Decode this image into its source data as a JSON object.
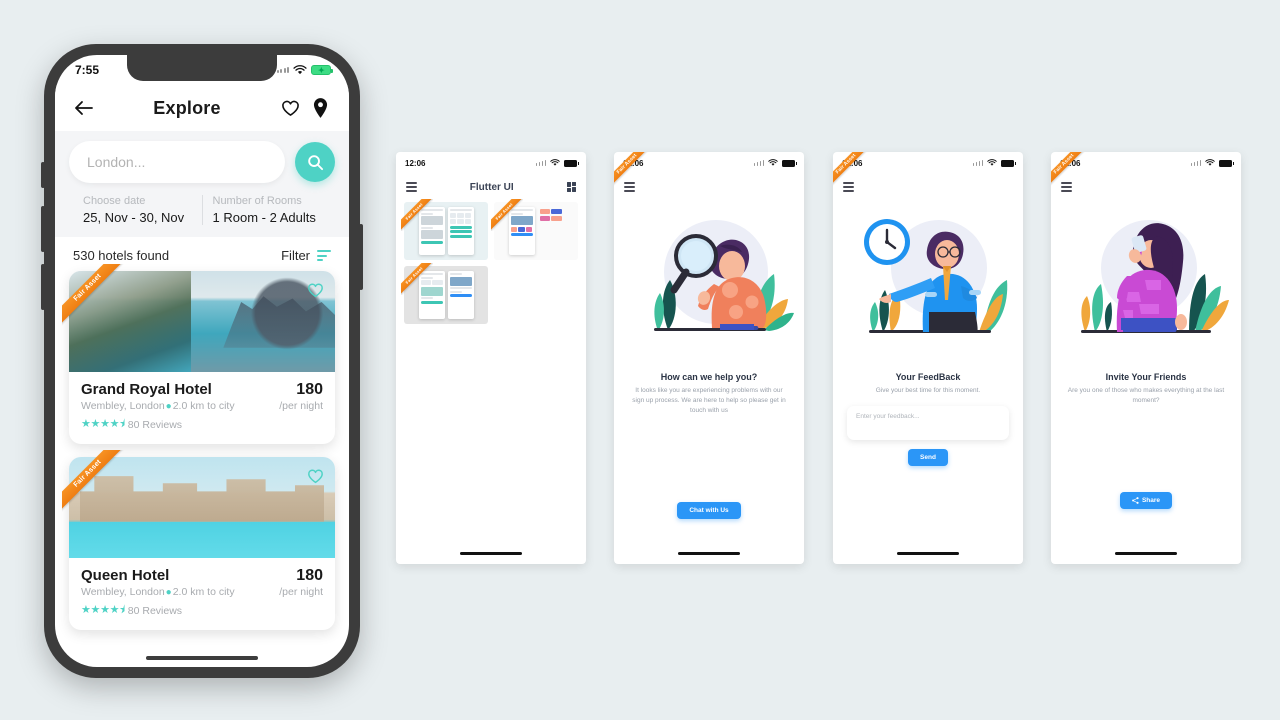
{
  "page": {
    "background_color": "#e8eef0",
    "ribbon_label": "Fair Asset",
    "accent_teal": "#4ed2c5",
    "accent_blue": "#2b96f7",
    "accent_orange": "#f08014"
  },
  "phone_main": {
    "status": {
      "time": "7:55",
      "wifi_icon": "wifi-icon",
      "battery_icon": "battery-charging-icon"
    },
    "appbar": {
      "back_icon": "arrow-left-icon",
      "title": "Explore",
      "favorite_icon": "heart-icon",
      "location_icon": "map-pin-icon"
    },
    "search": {
      "placeholder": "London...",
      "value": "London...",
      "button_icon": "search-icon"
    },
    "filters": {
      "date_label": "Choose date",
      "date_value": "25, Nov - 30, Nov",
      "rooms_label": "Number of Rooms",
      "rooms_value": "1 Room - 2 Adults"
    },
    "results": {
      "count_text": "530 hotels found",
      "filter_label": "Filter",
      "filter_icon": "filter-icon"
    },
    "hotels": [
      {
        "ribbon": "Fair Asset",
        "name": "Grand Royal Hotel",
        "location": "Wembley, London",
        "distance": "2.0 km to city",
        "price": "180",
        "price_unit": "/per night",
        "stars": "★★★★⯨",
        "reviews": "80 Reviews",
        "favorite_icon": "heart-outline-icon",
        "image_alt": "infinity-pool-city-view"
      },
      {
        "ribbon": "Fair Asset",
        "name": "Queen Hotel",
        "location": "Wembley, London",
        "distance": "2.0 km to city",
        "price": "180",
        "price_unit": "/per night",
        "stars": "★★★★⯨",
        "reviews": "80 Reviews",
        "favorite_icon": "heart-outline-icon",
        "image_alt": "resort-waterfront"
      }
    ]
  },
  "mini_screens": [
    {
      "id": "flutter-ui-gallery",
      "status_time": "12:06",
      "menu_icon": "hamburger-menu-icon",
      "title": "Flutter UI",
      "grid_icon": "grid-view-icon",
      "thumbnails": [
        {
          "ribbon": "Fair Asset",
          "alt": "hotel-booking-screens"
        },
        {
          "ribbon": "Fair Asset",
          "alt": "fitness-dashboard-screens"
        },
        {
          "ribbon": "Fair Asset",
          "alt": "design-course-screens"
        }
      ]
    },
    {
      "id": "help-screen",
      "status_time": "12:06",
      "ribbon": "Fair Asset",
      "menu_icon": "hamburger-menu-icon",
      "illustration": "man-with-magnifying-glass",
      "heading": "How can we help you?",
      "body": "It looks like you are experiencing problems with our sign up process. We are here to help so please get in touch with us",
      "button_label": "Chat with Us"
    },
    {
      "id": "feedback-screen",
      "status_time": "12:06",
      "ribbon": "Fair Asset",
      "menu_icon": "hamburger-menu-icon",
      "illustration": "man-with-clock",
      "heading": "Your FeedBack",
      "body": "Give your best time for this moment.",
      "input_placeholder": "Enter your feedback...",
      "button_label": "Send"
    },
    {
      "id": "invite-screen",
      "status_time": "12:06",
      "ribbon": "Fair Asset",
      "menu_icon": "hamburger-menu-icon",
      "illustration": "woman-on-phone",
      "heading": "Invite Your Friends",
      "body": "Are you one of those who makes everything at the last moment?",
      "button_label": "Share",
      "button_icon": "share-icon"
    }
  ]
}
